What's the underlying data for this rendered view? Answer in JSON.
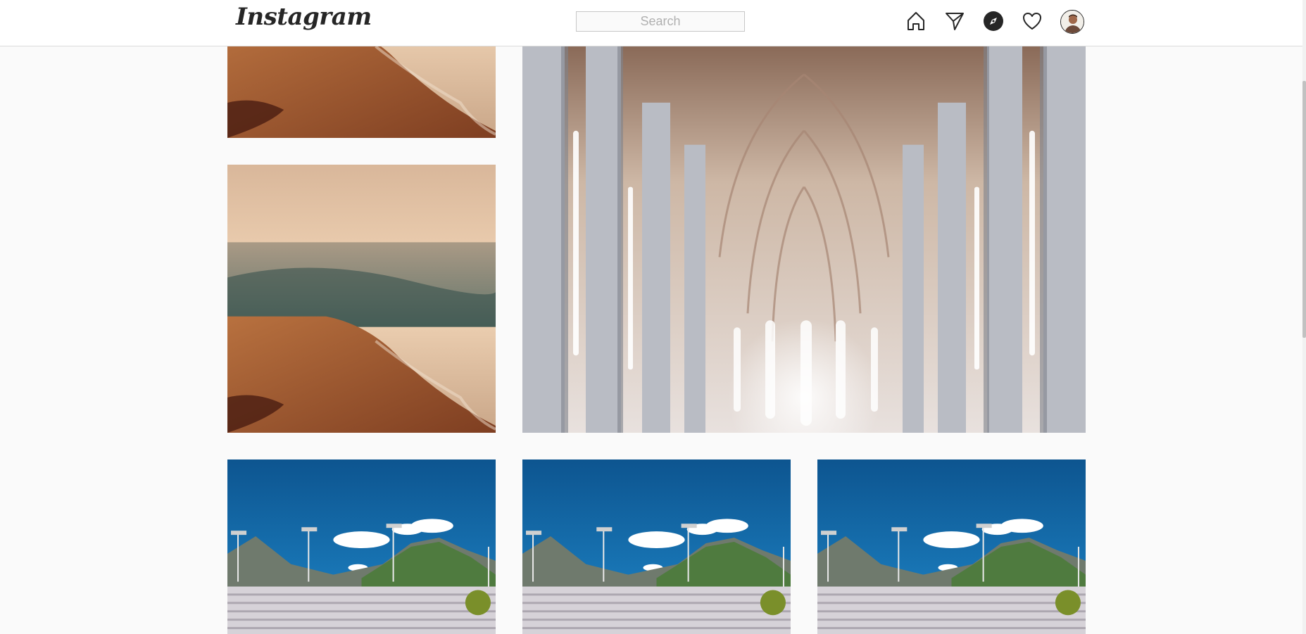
{
  "header": {
    "logo": "Instagram",
    "search_placeholder": "Search"
  },
  "nav": [
    {
      "name": "home-icon"
    },
    {
      "name": "direct-message-icon"
    },
    {
      "name": "explore-compass-icon"
    },
    {
      "name": "activity-heart-icon"
    },
    {
      "name": "profile-avatar"
    }
  ],
  "posts": [
    {
      "subject": "sand-shore-waves"
    },
    {
      "subject": "cathedral-interior"
    },
    {
      "subject": "sand-shore-waves"
    },
    {
      "subject": "stadium-mountains"
    },
    {
      "subject": "stadium-mountains"
    },
    {
      "subject": "stadium-mountains"
    }
  ],
  "colors": {
    "background": "#fafafa",
    "header": "#ffffff",
    "border": "#dbdbdb",
    "text": "#262626"
  }
}
